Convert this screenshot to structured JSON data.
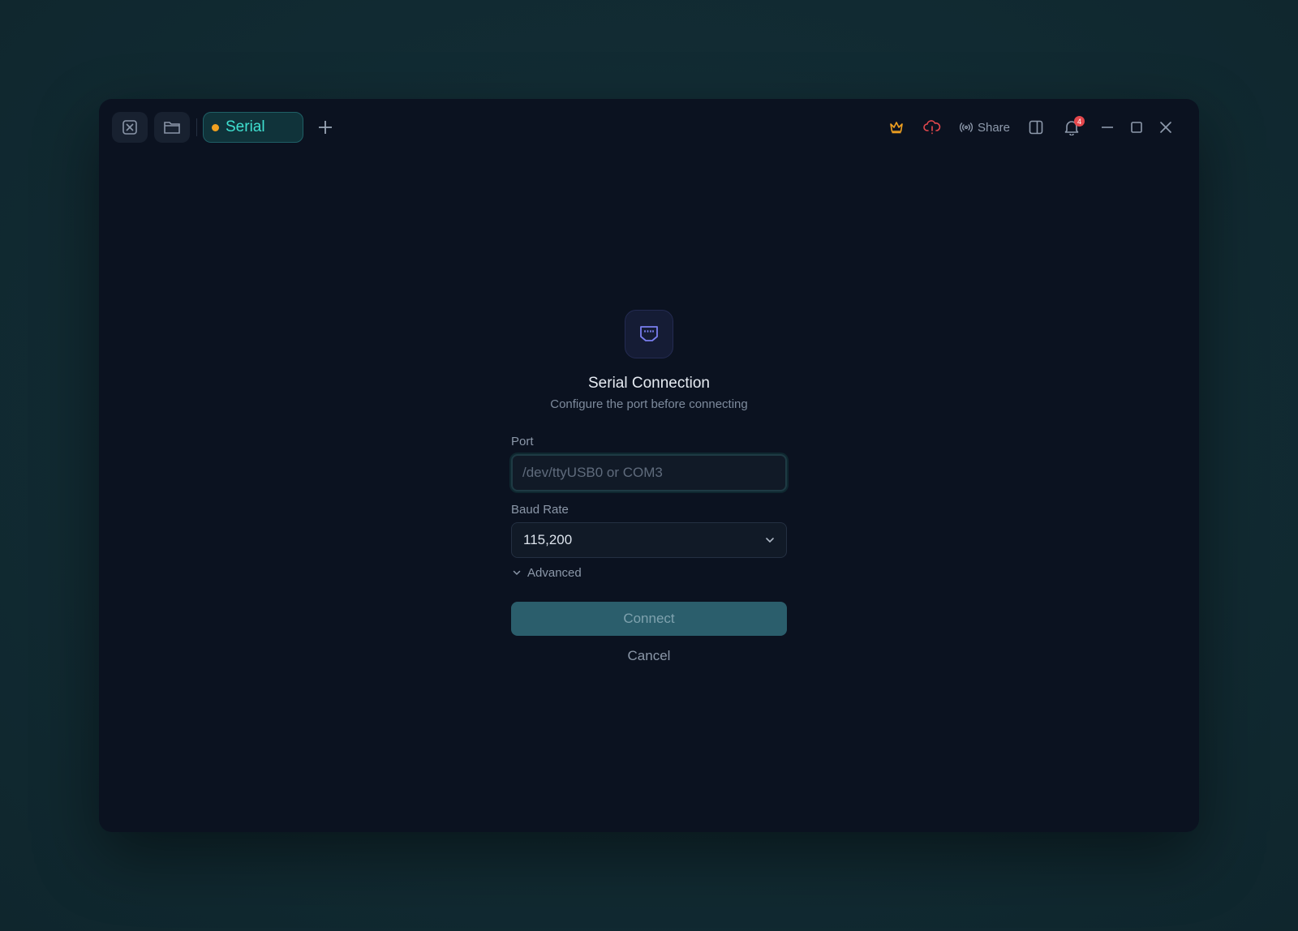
{
  "titlebar": {
    "tab": {
      "label": "Serial",
      "status_color": "#f0a020"
    },
    "share_label": "Share",
    "notification_count": "4",
    "icons": [
      "close-tab-icon",
      "folder-icon",
      "plus-icon",
      "crown-icon",
      "cloud-alert-icon",
      "broadcast-icon",
      "sidebar-toggle-icon",
      "bell-icon",
      "minimize-icon",
      "maximize-icon",
      "close-icon"
    ]
  },
  "dialog": {
    "icon": "serial-port-icon",
    "title": "Serial Connection",
    "subtitle": "Configure the port before connecting",
    "port": {
      "label": "Port",
      "value": "",
      "placeholder": "/dev/ttyUSB0 or COM3"
    },
    "baud": {
      "label": "Baud Rate",
      "value": "115,200"
    },
    "advanced_label": "Advanced",
    "connect_label": "Connect",
    "cancel_label": "Cancel"
  },
  "colors": {
    "accent": "#3fe0d0",
    "crown": "#f0a020",
    "cloud_alert": "#e5484d",
    "badge": "#e5484d",
    "connect_button": "#2b5e6c"
  }
}
